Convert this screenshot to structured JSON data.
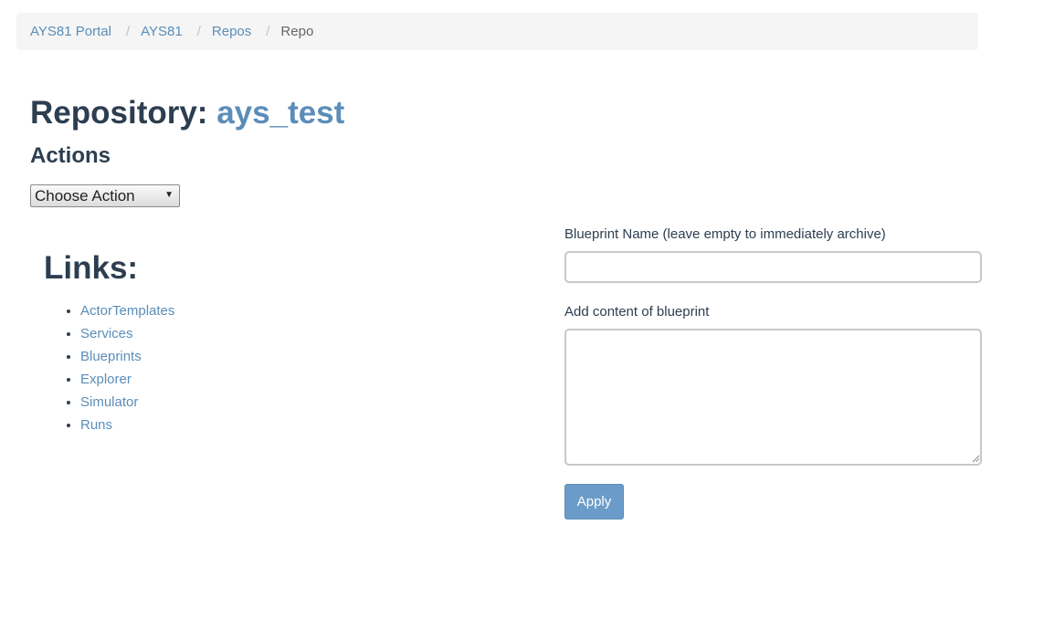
{
  "breadcrumb": {
    "items": [
      {
        "label": "AYS81 Portal"
      },
      {
        "label": "AYS81"
      },
      {
        "label": "Repos"
      }
    ],
    "separator": "/",
    "current": "Repo"
  },
  "header": {
    "title_prefix": "Repository:",
    "repo_name": "ays_test"
  },
  "actions": {
    "heading": "Actions",
    "select": {
      "selected": "Choose Action",
      "caret_icon": "caret-down-icon"
    }
  },
  "links": {
    "heading": "Links:",
    "items": [
      {
        "label": "ActorTemplates"
      },
      {
        "label": "Services"
      },
      {
        "label": "Blueprints"
      },
      {
        "label": "Explorer"
      },
      {
        "label": "Simulator"
      },
      {
        "label": "Runs"
      }
    ]
  },
  "form": {
    "blueprint_name_label": "Blueprint Name (leave empty to immediately archive)",
    "blueprint_name_value": "",
    "blueprint_content_label": "Add content of blueprint",
    "blueprint_content_value": "",
    "apply_label": "Apply"
  },
  "colors": {
    "link": "#5b8db8",
    "heading": "#2c3e50",
    "button_bg": "#6b9bc8",
    "breadcrumb_bg": "#f5f5f5"
  }
}
